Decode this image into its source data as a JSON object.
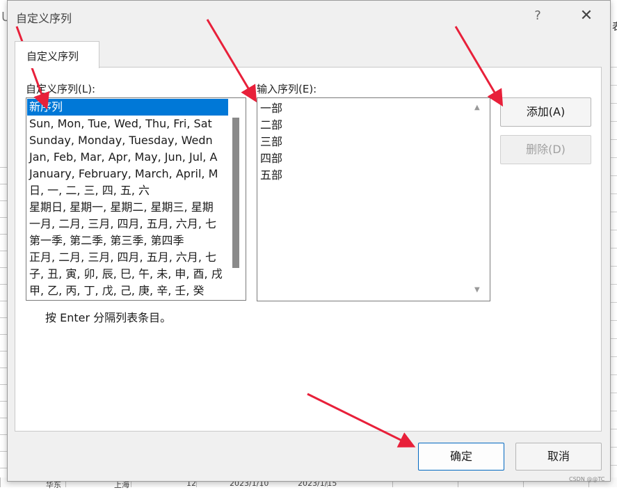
{
  "dialog": {
    "title": "自定义序列",
    "help_glyph": "?",
    "close_glyph": "✕",
    "tab_label": "自定义序列"
  },
  "custom_lists": {
    "label": "自定义序列(L):",
    "items": [
      "新序列",
      "Sun, Mon, Tue, Wed, Thu, Fri, Sat",
      "Sunday, Monday, Tuesday, Wedn",
      "Jan, Feb, Mar, Apr, May, Jun, Jul, A",
      "January, February, March, April, M",
      "日, 一, 二, 三, 四, 五, 六",
      "星期日, 星期一, 星期二, 星期三, 星期",
      "一月, 二月, 三月, 四月, 五月, 六月, 七",
      "第一季, 第二季, 第三季, 第四季",
      "正月, 二月, 三月, 四月, 五月, 六月, 七",
      "子, 丑, 寅, 卯, 辰, 巳, 午, 未, 申, 酉, 戌",
      "甲, 乙, 丙, 丁, 戊, 己, 庚, 辛, 壬, 癸"
    ],
    "selected_index": 0
  },
  "list_entries": {
    "label": "输入序列(E):",
    "lines": [
      "一部",
      "二部",
      "三部",
      "四部",
      "五部"
    ],
    "scroll_up_glyph": "▲",
    "scroll_down_glyph": "▼"
  },
  "buttons": {
    "add": "添加(A)",
    "delete": "删除(D)",
    "ok": "确定",
    "cancel": "取消"
  },
  "hint": "按 Enter 分隔列表条目。",
  "background": {
    "left_char": "U",
    "right_char": "表",
    "bottom_cells": [
      "华东",
      "上海",
      "12",
      "2023/1/10",
      "2023/1/15"
    ]
  },
  "watermark": "CSDN @@TC",
  "colors": {
    "selection": "#0078d7",
    "arrow": "#e8203a",
    "primary_border": "#0067c0"
  }
}
